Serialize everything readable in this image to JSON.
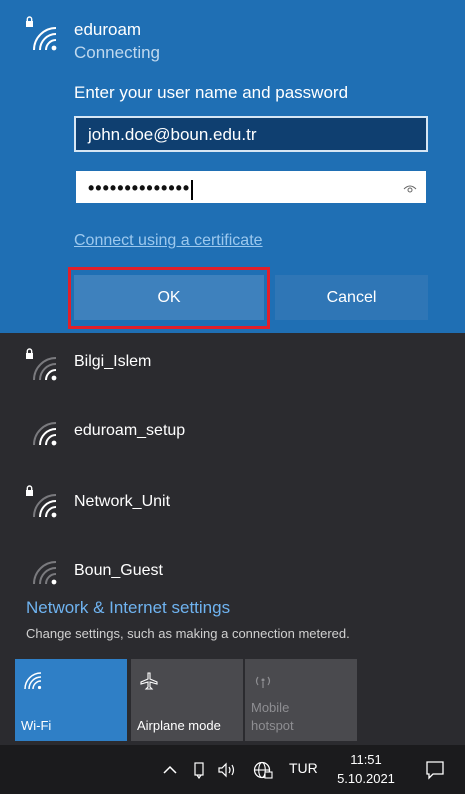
{
  "active_network": {
    "ssid": "eduroam",
    "status": "Connecting",
    "prompt": "Enter your user name and password",
    "username_value": "john.doe@boun.edu.tr",
    "password_mask": "••••••••••••••",
    "certificate_link": "Connect using a certificate",
    "ok_label": "OK",
    "cancel_label": "Cancel",
    "secured": true
  },
  "networks": [
    {
      "name": "Bilgi_Islem",
      "secured": true
    },
    {
      "name": "eduroam_setup",
      "secured": false
    },
    {
      "name": "Network_Unit",
      "secured": true
    },
    {
      "name": "Boun_Guest",
      "secured": false
    }
  ],
  "settings": {
    "title": "Network & Internet settings",
    "subtitle": "Change settings, such as making a connection metered."
  },
  "quick_actions": [
    {
      "label": "Wi-Fi",
      "icon": "wifi-icon",
      "active": true
    },
    {
      "label": "Airplane mode",
      "icon": "airplane-icon",
      "active": false
    },
    {
      "label": "Mobile hotspot",
      "icon": "hotspot-icon",
      "active": false,
      "disabled": true
    }
  ],
  "taskbar": {
    "language": "TUR",
    "time": "11:51",
    "date": "5.10.2021"
  },
  "colors": {
    "accent": "#1f6fb4",
    "highlight_box": "#e2202a",
    "link": "#6fb3f0"
  }
}
